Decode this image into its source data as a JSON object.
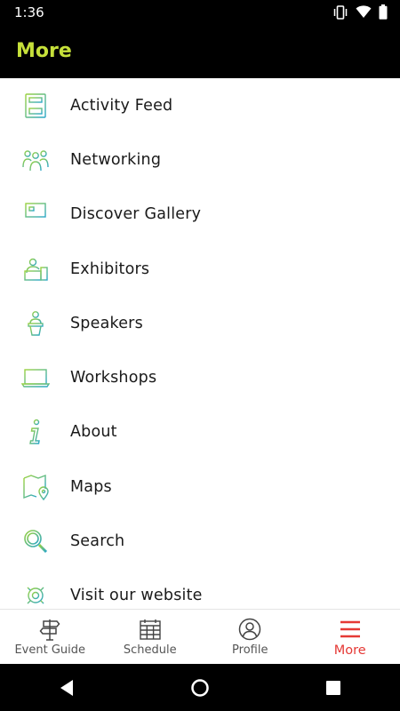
{
  "status_bar": {
    "time": "1:36",
    "icons": [
      "vibrate-icon",
      "wifi-icon",
      "battery-icon"
    ]
  },
  "app_bar": {
    "title": "More",
    "title_color": "#c6e03a",
    "background": "#000000"
  },
  "menu": {
    "items": [
      {
        "label": "Activity Feed",
        "icon": "activity-feed-icon"
      },
      {
        "label": "Networking",
        "icon": "networking-icon"
      },
      {
        "label": "Discover Gallery",
        "icon": "gallery-icon"
      },
      {
        "label": "Exhibitors",
        "icon": "exhibitors-icon"
      },
      {
        "label": "Speakers",
        "icon": "speakers-icon"
      },
      {
        "label": "Workshops",
        "icon": "workshops-icon"
      },
      {
        "label": "About",
        "icon": "info-icon"
      },
      {
        "label": "Maps",
        "icon": "map-icon"
      },
      {
        "label": "Search",
        "icon": "search-icon"
      },
      {
        "label": "Visit our website",
        "icon": "website-icon"
      }
    ],
    "icon_gradient": [
      "#9bd23f",
      "#2aa7c9"
    ]
  },
  "bottom_nav": {
    "items": [
      {
        "label": "Event Guide",
        "icon": "signpost-icon",
        "active": false
      },
      {
        "label": "Schedule",
        "icon": "calendar-icon",
        "active": false
      },
      {
        "label": "Profile",
        "icon": "profile-icon",
        "active": false
      },
      {
        "label": "More",
        "icon": "hamburger-icon",
        "active": true
      }
    ],
    "active_color": "#e53935"
  },
  "system_nav": {
    "buttons": [
      "back-icon",
      "home-icon",
      "recents-icon"
    ]
  }
}
